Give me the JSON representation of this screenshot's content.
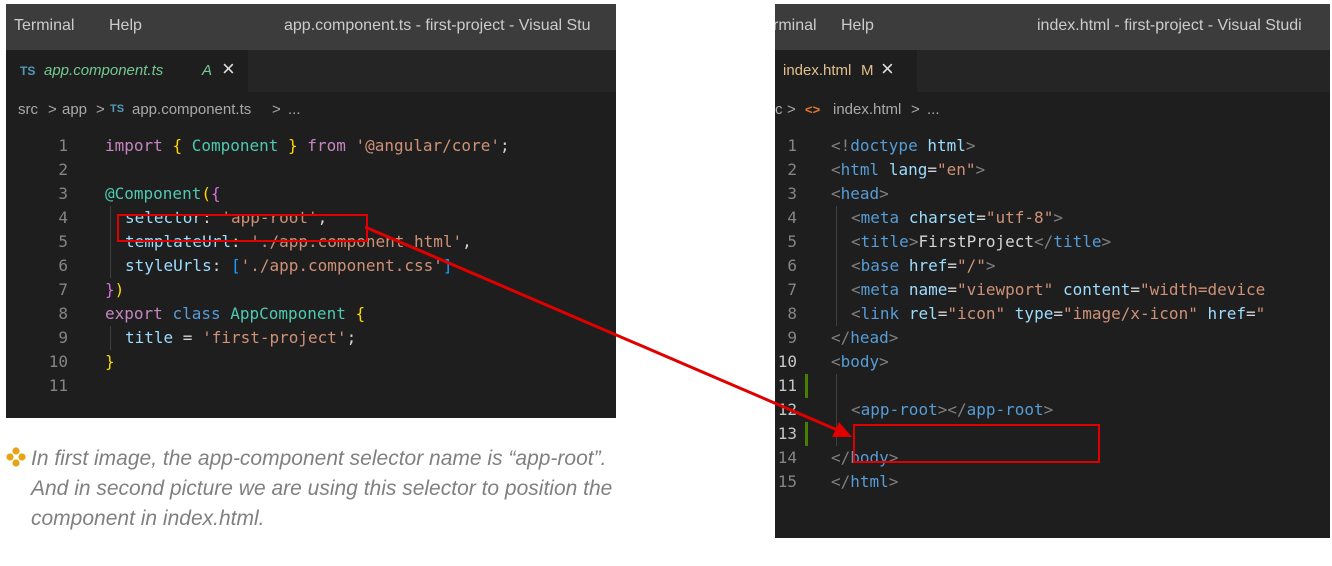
{
  "window1": {
    "menu": [
      "Terminal",
      "Help"
    ],
    "title": "app.component.ts - first-project - Visual Stu",
    "tab": {
      "lang_badge": "TS",
      "name": "app.component.ts",
      "status": "A",
      "close": "×"
    },
    "breadcrumb": [
      "src",
      ">",
      "app",
      ">",
      "TS",
      "app.component.ts",
      ">",
      "..."
    ],
    "line_numbers": [
      "1",
      "2",
      "3",
      "4",
      "5",
      "6",
      "7",
      "8",
      "9",
      "10",
      "11"
    ]
  },
  "window2": {
    "menu": [
      "rminal",
      "Help"
    ],
    "title": "index.html - first-project - Visual Studi",
    "tab": {
      "name": "index.html",
      "status": "M",
      "close": "×"
    },
    "breadcrumb": [
      "c",
      ">",
      "<>",
      "index.html",
      ">",
      "..."
    ],
    "line_numbers": [
      "1",
      "2",
      "3",
      "4",
      "5",
      "6",
      "7",
      "8",
      "9",
      "10",
      "11",
      "12",
      "13",
      "14",
      "15"
    ]
  },
  "code1": [
    [
      [
        "import ",
        "c-kw"
      ],
      [
        "{ ",
        "c-brk"
      ],
      [
        "Component ",
        "c-cls"
      ],
      [
        "}",
        "c-brk"
      ],
      [
        " from ",
        "c-kw"
      ],
      [
        "'@angular/core'",
        "c-str"
      ],
      [
        ";",
        "c-def"
      ]
    ],
    [],
    [
      [
        "@Component",
        "c-cls"
      ],
      [
        "(",
        "c-brk"
      ],
      [
        "{",
        "c-brk2"
      ]
    ],
    [
      [
        "selector",
        "c-id"
      ],
      [
        ": ",
        "c-def"
      ],
      [
        "'app-root'",
        "c-str"
      ],
      [
        ",",
        "c-def"
      ]
    ],
    [
      [
        "templateUrl",
        "c-id"
      ],
      [
        ": ",
        "c-def"
      ],
      [
        "'./app.component.html'",
        "c-str"
      ],
      [
        ",",
        "c-def"
      ]
    ],
    [
      [
        "styleUrls",
        "c-id"
      ],
      [
        ": ",
        "c-def"
      ],
      [
        "[",
        "c-blue"
      ],
      [
        "'./app.component.css'",
        "c-str"
      ],
      [
        "]",
        "c-blue"
      ]
    ],
    [
      [
        "}",
        "c-brk2"
      ],
      [
        ")",
        "c-brk"
      ]
    ],
    [
      [
        "export ",
        "c-kw"
      ],
      [
        "class ",
        "c-tag"
      ],
      [
        "AppComponent ",
        "c-cls"
      ],
      [
        "{",
        "c-brk"
      ]
    ],
    [
      [
        "title ",
        "c-id"
      ],
      [
        "= ",
        "c-def"
      ],
      [
        "'first-project'",
        "c-str"
      ],
      [
        ";",
        "c-def"
      ]
    ],
    [
      [
        "}",
        "c-brk"
      ]
    ],
    []
  ],
  "code2": [
    [
      [
        "<!",
        "c-gray"
      ],
      [
        "doctype ",
        "c-tag"
      ],
      [
        "html",
        "c-id"
      ],
      [
        ">",
        "c-gray"
      ]
    ],
    [
      [
        "<",
        "c-gray"
      ],
      [
        "html ",
        "c-tag"
      ],
      [
        "lang",
        "c-id"
      ],
      [
        "=",
        "c-def"
      ],
      [
        "\"en\"",
        "c-str"
      ],
      [
        ">",
        "c-gray"
      ]
    ],
    [
      [
        "<",
        "c-gray"
      ],
      [
        "head",
        "c-tag"
      ],
      [
        ">",
        "c-gray"
      ]
    ],
    [
      [
        "<",
        "c-gray"
      ],
      [
        "meta ",
        "c-tag"
      ],
      [
        "charset",
        "c-id"
      ],
      [
        "=",
        "c-def"
      ],
      [
        "\"utf-8\"",
        "c-str"
      ],
      [
        ">",
        "c-gray"
      ]
    ],
    [
      [
        "<",
        "c-gray"
      ],
      [
        "title",
        "c-tag"
      ],
      [
        ">",
        "c-gray"
      ],
      [
        "FirstProject",
        "c-def"
      ],
      [
        "</",
        "c-gray"
      ],
      [
        "title",
        "c-tag"
      ],
      [
        ">",
        "c-gray"
      ]
    ],
    [
      [
        "<",
        "c-gray"
      ],
      [
        "base ",
        "c-tag"
      ],
      [
        "href",
        "c-id"
      ],
      [
        "=",
        "c-def"
      ],
      [
        "\"/\"",
        "c-str"
      ],
      [
        ">",
        "c-gray"
      ]
    ],
    [
      [
        "<",
        "c-gray"
      ],
      [
        "meta ",
        "c-tag"
      ],
      [
        "name",
        "c-id"
      ],
      [
        "=",
        "c-def"
      ],
      [
        "\"viewport\" ",
        "c-str"
      ],
      [
        "content",
        "c-id"
      ],
      [
        "=",
        "c-def"
      ],
      [
        "\"width=device",
        "c-str"
      ]
    ],
    [
      [
        "<",
        "c-gray"
      ],
      [
        "link ",
        "c-tag"
      ],
      [
        "rel",
        "c-id"
      ],
      [
        "=",
        "c-def"
      ],
      [
        "\"icon\" ",
        "c-str"
      ],
      [
        "type",
        "c-id"
      ],
      [
        "=",
        "c-def"
      ],
      [
        "\"image/x-icon\" ",
        "c-str"
      ],
      [
        "href",
        "c-id"
      ],
      [
        "=",
        "c-def"
      ],
      [
        "\"",
        "c-str"
      ]
    ],
    [
      [
        "</",
        "c-gray"
      ],
      [
        "head",
        "c-tag"
      ],
      [
        ">",
        "c-gray"
      ]
    ],
    [
      [
        "<",
        "c-gray"
      ],
      [
        "body",
        "c-tag"
      ],
      [
        ">",
        "c-gray"
      ]
    ],
    [],
    [
      [
        "<",
        "c-gray"
      ],
      [
        "app-root",
        "c-tag"
      ],
      [
        "></",
        "c-gray"
      ],
      [
        "app-root",
        "c-tag"
      ],
      [
        ">",
        "c-gray"
      ]
    ],
    [],
    [
      [
        "</",
        "c-gray"
      ],
      [
        "body",
        "c-tag"
      ],
      [
        ">",
        "c-gray"
      ]
    ],
    [
      [
        "</",
        "c-gray"
      ],
      [
        "html",
        "c-tag"
      ],
      [
        ">",
        "c-gray"
      ]
    ]
  ],
  "caption": {
    "text": "In first image, the app-component selector name is “app-root”. And in second picture we are using this selector to position the component in index.html."
  },
  "colors": {
    "highlight": "#e00000",
    "arrow": "#e00000",
    "bullet": "#e8a417",
    "tab_ts": "#519aba",
    "tab_html": "#e37933",
    "git_added": "#487e02"
  },
  "icons": {
    "bullet": "diamond-bullet-icon",
    "tab1": "typescript-file-icon",
    "tab2": "html-file-icon",
    "close": "close-icon"
  }
}
